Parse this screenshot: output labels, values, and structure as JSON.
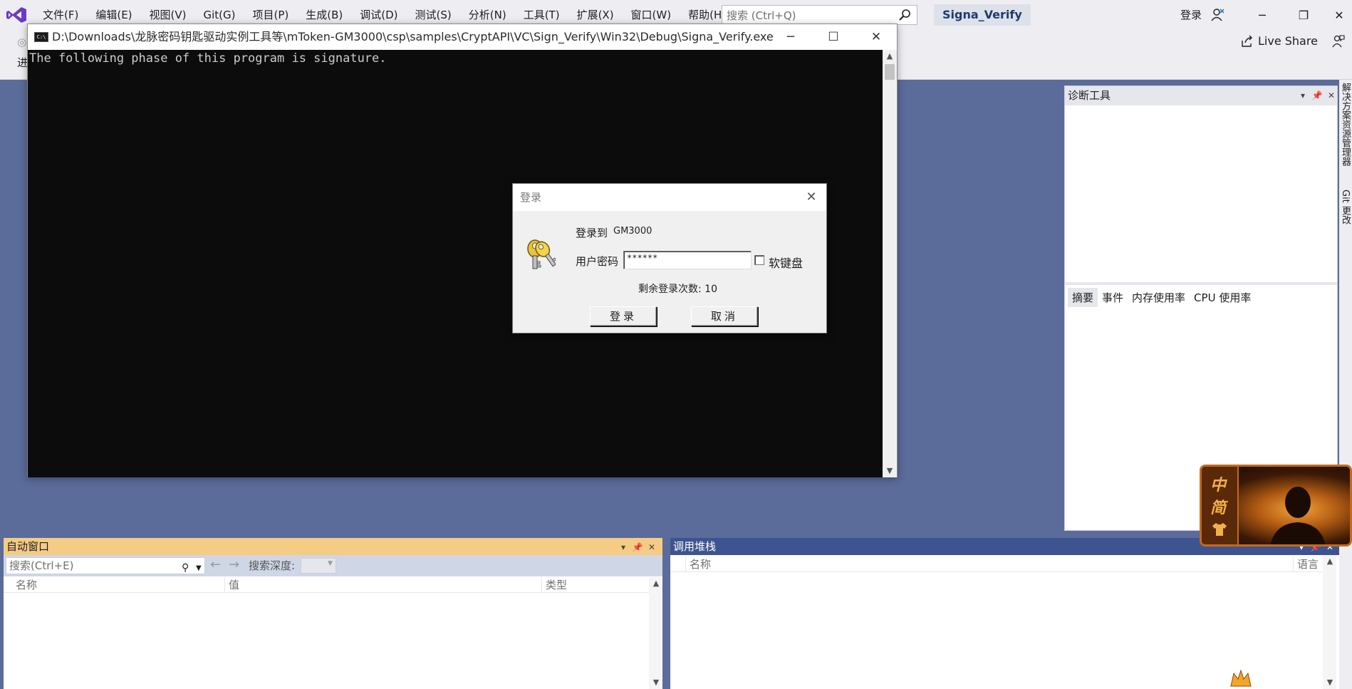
{
  "vs": {
    "menu": [
      "文件(F)",
      "编辑(E)",
      "视图(V)",
      "Git(G)",
      "项目(P)",
      "生成(B)",
      "调试(D)",
      "测试(S)",
      "分析(N)",
      "工具(T)",
      "扩展(X)",
      "窗口(W)",
      "帮助(H)"
    ],
    "search_placeholder": "搜索 (Ctrl+Q)",
    "solution_name": "Signa_Verify",
    "login_label": "登录",
    "live_share_label": "Live Share",
    "toolbar_fragment": "进"
  },
  "console": {
    "path": "D:\\Downloads\\龙脉密码钥匙驱动实例工具等\\mToken-GM3000\\csp\\samples\\CryptAPI\\VC\\Sign_Verify\\Win32\\Debug\\Signa_Verify.exe",
    "icon_text": "C:\\",
    "output": "The following phase of this program is signature."
  },
  "login_dialog": {
    "title": "登录",
    "login_to": "登录到",
    "device": "GM3000",
    "password_label": "用户密码",
    "password_value": "******",
    "soft_keyboard_label": "软键盘",
    "remaining_label": "剩余登录次数: 10",
    "ok_label": "登录",
    "cancel_label": "取消"
  },
  "diagnostics": {
    "title": "诊断工具",
    "tabs": [
      "摘要",
      "事件",
      "内存使用率",
      "CPU 使用率"
    ],
    "active_tab": 0
  },
  "side_tabs": [
    "解决方案资源管理器",
    "Git 更改"
  ],
  "auto_window": {
    "title": "自动窗口",
    "search_placeholder": "搜索(Ctrl+E)",
    "depth_label": "搜索深度:",
    "columns": [
      "名称",
      "值",
      "类型"
    ]
  },
  "call_stack": {
    "title": "调用堆栈",
    "columns": [
      "名称",
      "语言"
    ]
  },
  "webcam": {
    "brand_chars": [
      "中",
      "简"
    ]
  },
  "colors": {
    "background": "#5b6b9a",
    "auto_header": "#f5cc84",
    "stack_header": "#3e5490",
    "console_bg": "#0c0c0c"
  }
}
